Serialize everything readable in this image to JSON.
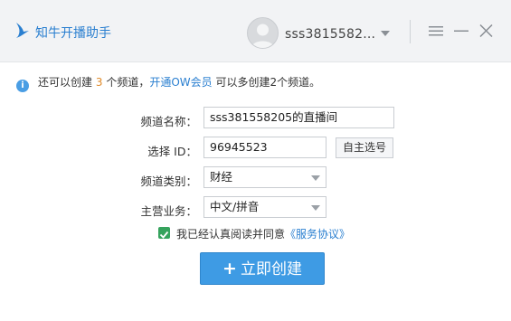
{
  "app": {
    "title": "知牛开播助手",
    "username": "sss3815582..."
  },
  "notice": {
    "part1": "还可以创建",
    "count": "3",
    "part2": "个频道，",
    "link": "开通OW会员",
    "part3": "可以多创建2个频道。"
  },
  "form": {
    "channel_name_label": "频道名称：",
    "channel_name_value": "sss381558205的直播间",
    "id_label": "选择 ID：",
    "id_value": "96945523",
    "id_button": "自主选号",
    "category_label": "频道类别：",
    "category_value": "财经",
    "business_label": "主营业务：",
    "business_value": "中文/拼音",
    "agree_text": "我已经认真阅读并同意",
    "agree_link": "《服务协议》",
    "agree_checked": true,
    "create_button": "立即创建"
  },
  "colors": {
    "accent": "#3e9be4",
    "link": "#2a7fd0",
    "highlight": "#e08a2a",
    "check": "#36a35d"
  }
}
